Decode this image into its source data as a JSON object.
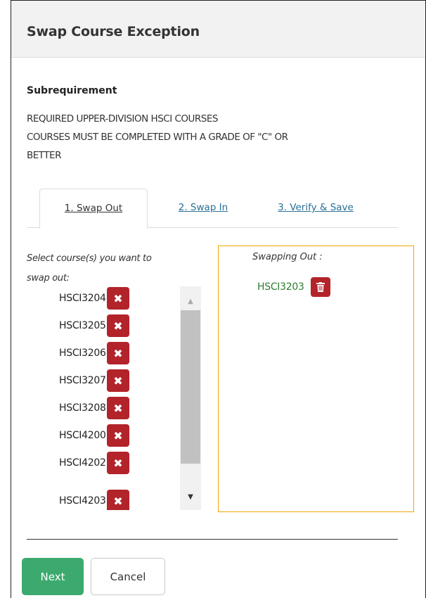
{
  "modal": {
    "title": "Swap Course Exception"
  },
  "subrequirement": {
    "heading": "Subrequirement",
    "lines": [
      "REQUIRED UPPER-DIVISION HSCI COURSES",
      "COURSES MUST BE COMPLETED WITH A GRADE OF \"C\" OR",
      "BETTER"
    ]
  },
  "tabs": [
    {
      "label": "1. Swap Out",
      "active": true
    },
    {
      "label": "2. Swap In",
      "active": false
    },
    {
      "label": "3. Verify & Save",
      "active": false
    }
  ],
  "swap_out": {
    "instruction_line1": "Select course(s) you want to",
    "instruction_line2": "swap out:",
    "courses": [
      "HSCI3204",
      "HSCI3205",
      "HSCI3206",
      "HSCI3207",
      "HSCI3208",
      "HSCI4200",
      "HSCI4202",
      "HSCI4203"
    ],
    "remove_icon": "x-icon",
    "selected_label": "Swapping Out :",
    "selected": [
      "HSCI3203"
    ],
    "selected_icon": "trash-icon"
  },
  "buttons": {
    "next": "Next",
    "cancel": "Cancel"
  },
  "colors": {
    "remove_button": "#b3232a",
    "next_button": "#3caa6e",
    "selection_border": "#f0a500",
    "selected_course_text": "#2e7d32",
    "tab_link": "#2a6f97"
  }
}
